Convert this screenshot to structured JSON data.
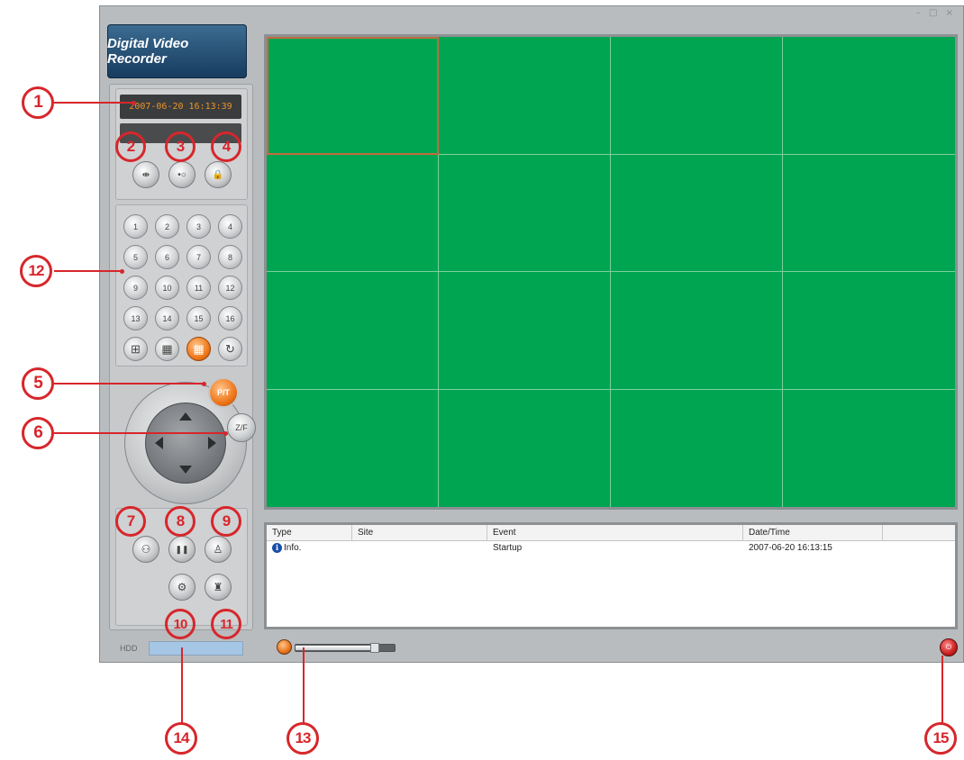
{
  "window": {
    "controls": "– □ ×"
  },
  "brand": {
    "title": "Digital Video Recorder"
  },
  "clock": {
    "datetime": "2007-06-20 16:13:39"
  },
  "top_buttons": [
    {
      "icon": "network-icon",
      "glyph": "⇼"
    },
    {
      "icon": "record-icon",
      "glyph": "•○"
    },
    {
      "icon": "lock-icon",
      "glyph": "🔒"
    }
  ],
  "channels": [
    "1",
    "2",
    "3",
    "4",
    "5",
    "6",
    "7",
    "8",
    "9",
    "10",
    "11",
    "12",
    "13",
    "14",
    "15",
    "16"
  ],
  "layout_buttons": [
    {
      "icon": "quad-view-icon",
      "glyph": "⊞"
    },
    {
      "icon": "nine-view-icon",
      "glyph": "▦"
    },
    {
      "icon": "sixteen-view-icon",
      "glyph": "▦",
      "active": true
    },
    {
      "icon": "sequence-icon",
      "glyph": "↻"
    }
  ],
  "ptz": {
    "pt_label": "P/T",
    "zf_label": "Z/F"
  },
  "bottom_buttons": [
    {
      "icon": "playback-icon",
      "glyph": "⚇"
    },
    {
      "icon": "pause-icon",
      "glyph": "❚❚"
    },
    {
      "icon": "user-icon",
      "glyph": "♙"
    },
    {
      "icon": "settings-icon",
      "glyph": "⚙"
    },
    {
      "icon": "log-icon",
      "glyph": "♜"
    }
  ],
  "log": {
    "columns": [
      "Type",
      "Site",
      "Event",
      "Date/Time"
    ],
    "rows": [
      {
        "type": "Info.",
        "site": "",
        "event": "Startup",
        "datetime": "2007-06-20 16:13:15"
      }
    ]
  },
  "status": {
    "hdd_label": "HDD",
    "volume_level": 0.8
  },
  "callouts": [
    "1",
    "2",
    "3",
    "4",
    "5",
    "6",
    "7",
    "8",
    "9",
    "10",
    "11",
    "12",
    "13",
    "14",
    "15"
  ],
  "colors": {
    "video_bg": "#00a552",
    "accent": "#ee761a",
    "callout": "#d7262b"
  }
}
